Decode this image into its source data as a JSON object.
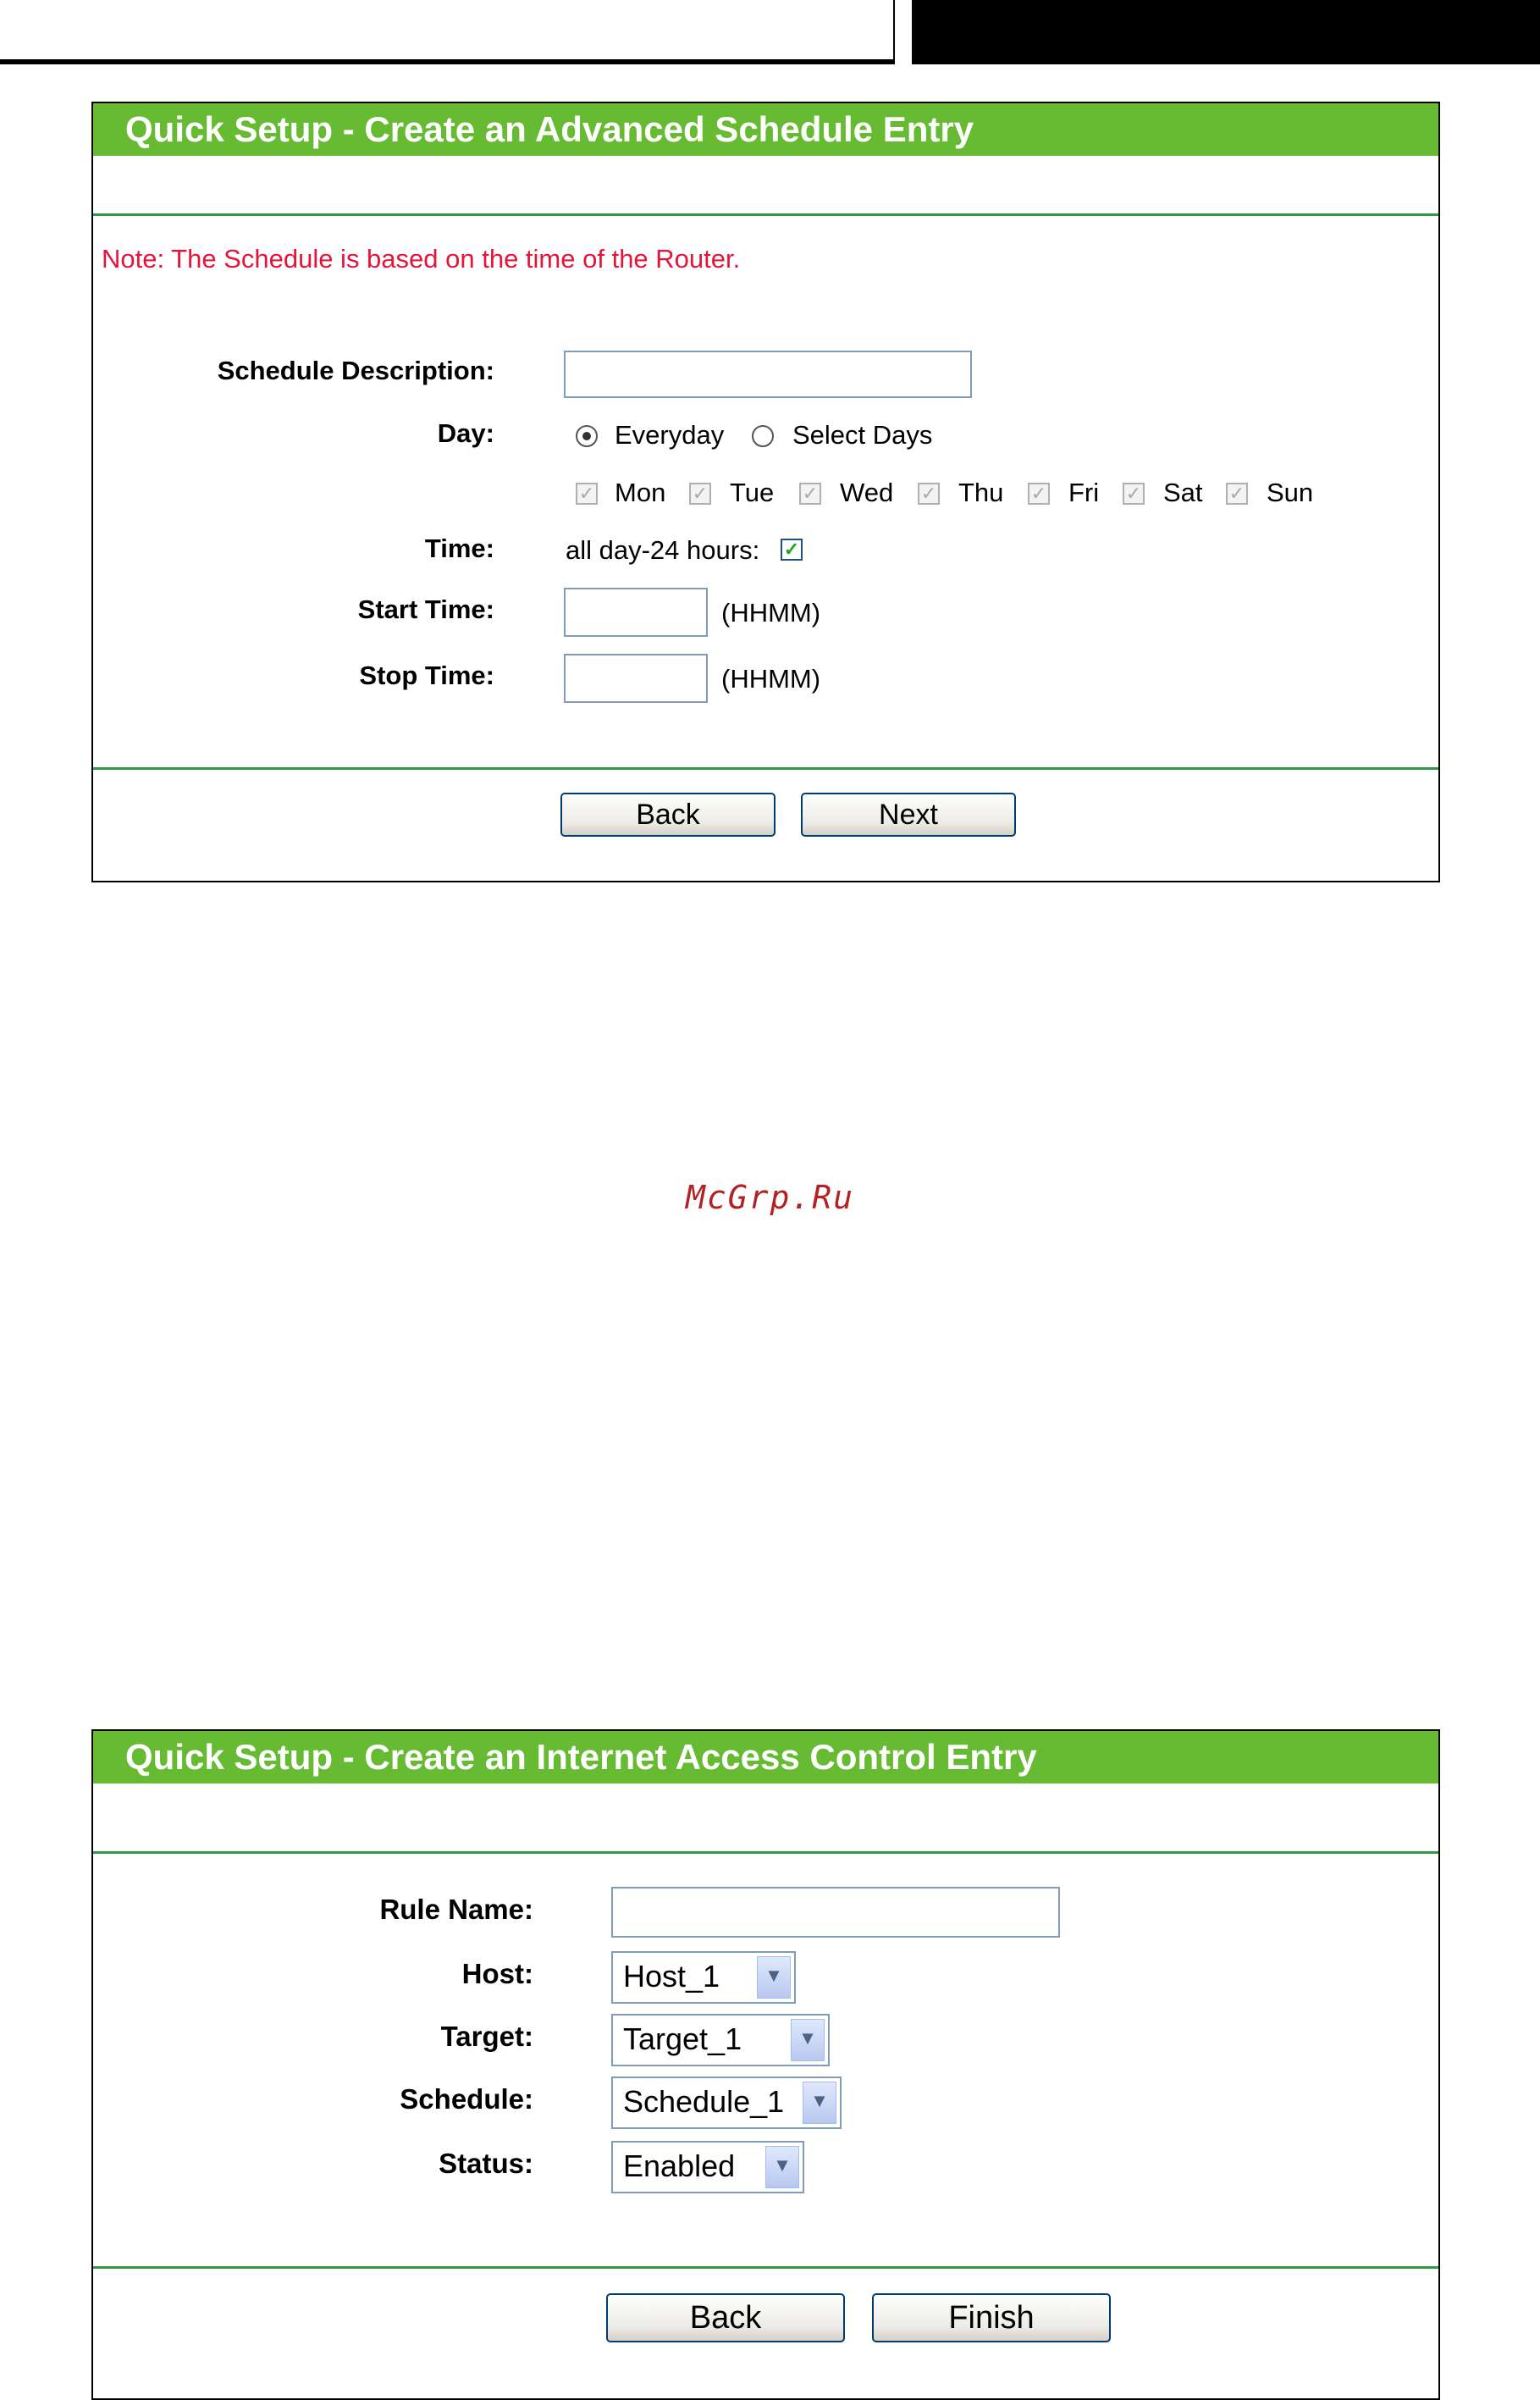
{
  "schedule_panel": {
    "title": "Quick Setup - Create an Advanced Schedule Entry",
    "note": "Note: The Schedule is based on the time of the Router.",
    "description_label": "Schedule Description:",
    "description_value": "",
    "day_label": "Day:",
    "day_options": {
      "everyday": "Everyday",
      "select_days": "Select Days",
      "selected": "Everyday"
    },
    "days": [
      "Mon",
      "Tue",
      "Wed",
      "Thu",
      "Fri",
      "Sat",
      "Sun"
    ],
    "time_label": "Time:",
    "all_day_label": "all day-24 hours:",
    "all_day_checked": true,
    "start_label": "Start Time:",
    "stop_label": "Stop Time:",
    "time_hint": "(HHMM)",
    "back_label": "Back",
    "next_label": "Next"
  },
  "watermark": "McGrp.Ru",
  "access_panel": {
    "title": "Quick Setup - Create an Internet Access Control Entry",
    "rule_name_label": "Rule Name:",
    "rule_name_value": "",
    "host_label": "Host:",
    "host_value": "Host_1",
    "target_label": "Target:",
    "target_value": "Target_1",
    "schedule_label": "Schedule:",
    "schedule_value": "Schedule_1",
    "status_label": "Status:",
    "status_value": "Enabled",
    "back_label": "Back",
    "finish_label": "Finish"
  }
}
